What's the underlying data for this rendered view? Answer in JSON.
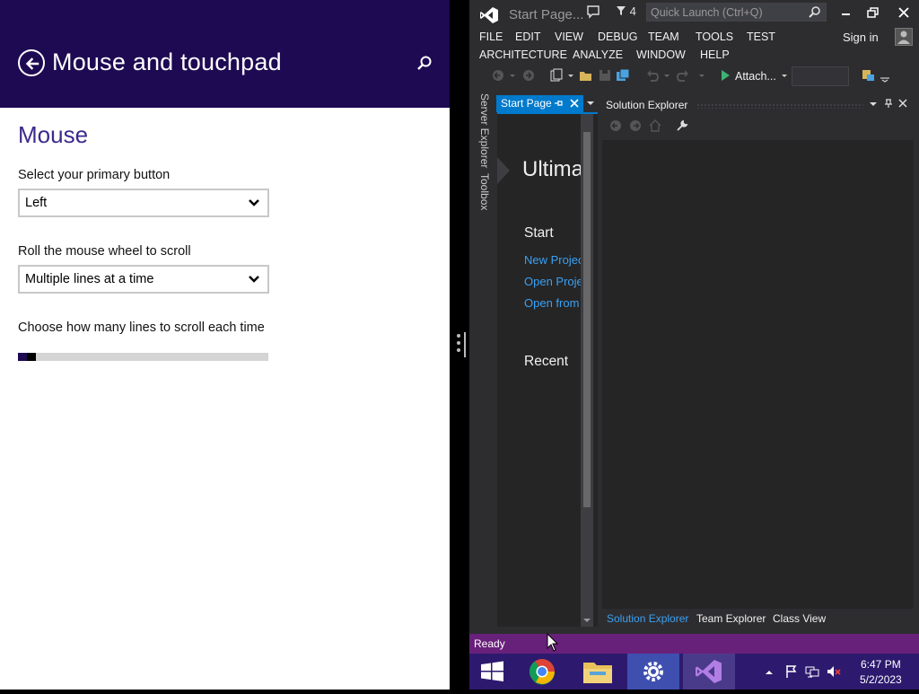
{
  "settings": {
    "title": "Mouse and touchpad",
    "section": "Mouse",
    "primary_button": {
      "label": "Select your primary button",
      "value": "Left"
    },
    "wheel_scroll": {
      "label": "Roll the mouse wheel to scroll",
      "value": "Multiple lines at a time"
    },
    "lines_slider": {
      "label": "Choose how many lines to scroll each time",
      "level_fraction": 0.05
    }
  },
  "vs": {
    "title": "Start Page...",
    "notification_count": "4",
    "quick_launch_placeholder": "Quick Launch (Ctrl+Q)",
    "menu": [
      "FILE",
      "EDIT",
      "VIEW",
      "DEBUG",
      "TEAM",
      "TOOLS",
      "TEST",
      "ARCHITECTURE",
      "ANALYZE",
      "WINDOW",
      "HELP"
    ],
    "sign_in": "Sign in",
    "attach_label": "Attach...",
    "side_tabs": [
      "Server Explorer",
      "Toolbox"
    ],
    "doc_tab": "Start Page",
    "start_page": {
      "heading": "Ultima",
      "start": "Start",
      "links": [
        "New Projec",
        "Open Proje",
        "Open from"
      ],
      "recent": "Recent"
    },
    "solution_explorer": {
      "title": "Solution Explorer",
      "bottom_tabs": [
        "Solution Explorer",
        "Team Explorer",
        "Class View"
      ]
    },
    "status": "Ready",
    "accent": "#007acc",
    "status_color": "#68217a"
  },
  "taskbar": {
    "apps": [
      "windows-start",
      "chrome",
      "file-explorer",
      "settings",
      "visual-studio"
    ],
    "time": "6:47 PM",
    "date": "5/2/2023",
    "color": "#2d1a6e"
  }
}
